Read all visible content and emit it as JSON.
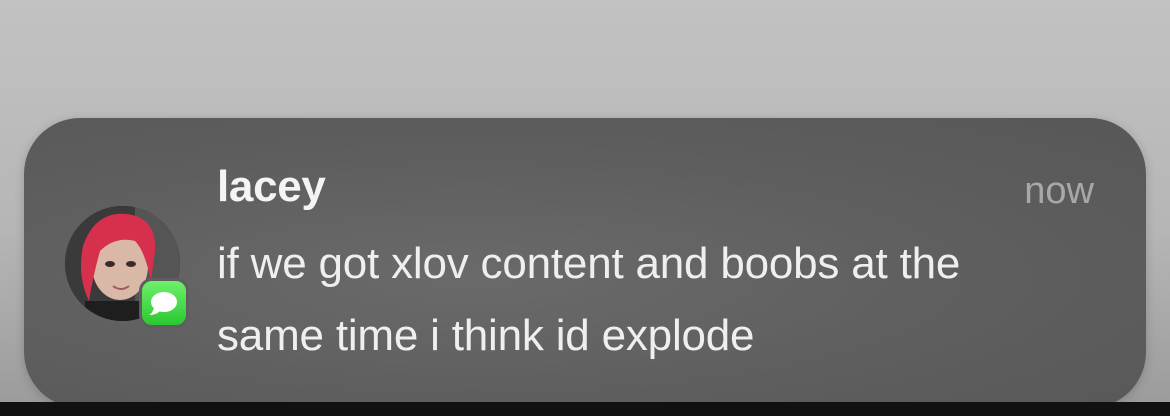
{
  "notification": {
    "sender": "lacey",
    "time": "now",
    "message": "if we got xlov content and boobs at the same time i think id explode",
    "app_icon": "messages-icon",
    "avatar": "contact-avatar"
  },
  "colors": {
    "banner_background": "#5e5e5e",
    "badge_green": "#34c759",
    "sender_text": "#f4f4f4",
    "message_text": "#efefef",
    "time_text": "#a8a8a8"
  }
}
